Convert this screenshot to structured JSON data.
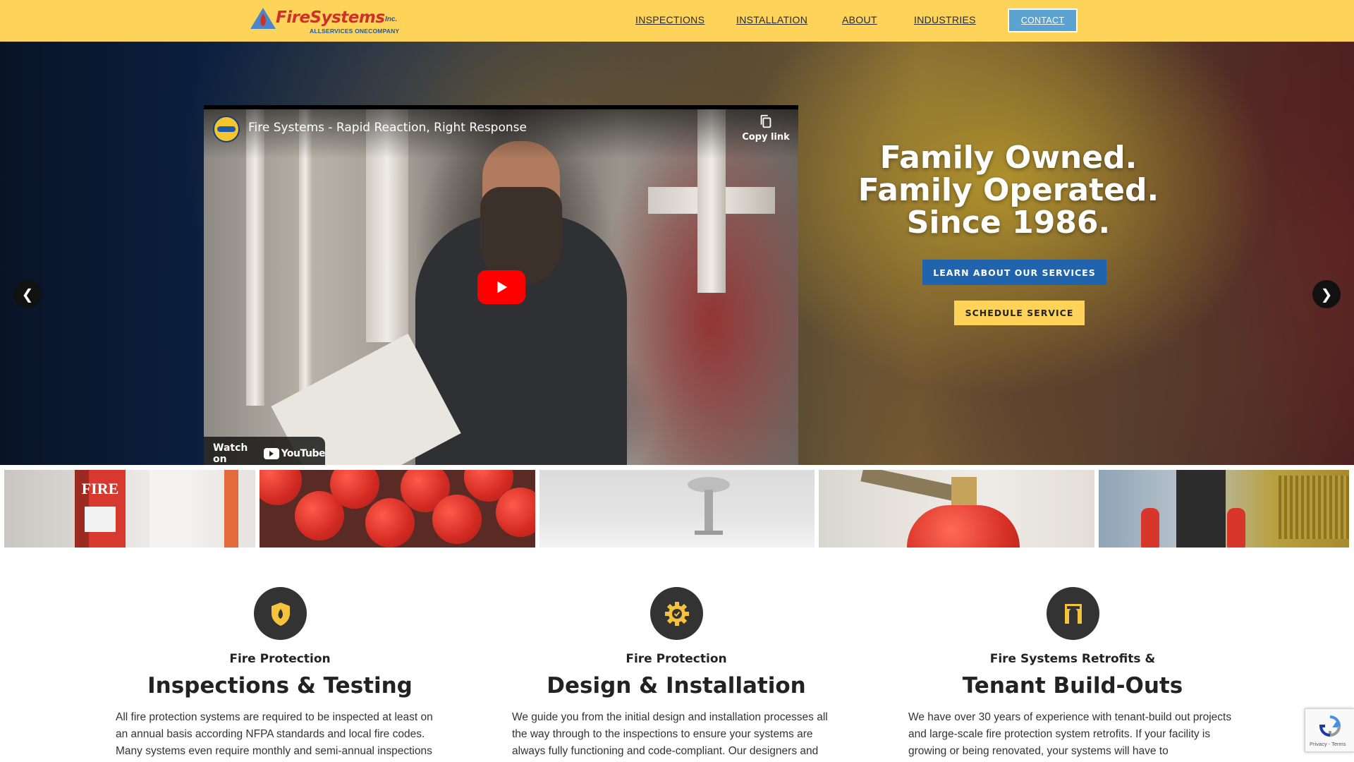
{
  "header": {
    "logo": {
      "name": "FireSystems",
      "suffix": "Inc.",
      "tagline": "ALLSERVICES ONECOMPANY"
    },
    "nav": [
      "INSPECTIONS",
      "INSTALLATION",
      "ABOUT",
      "INDUSTRIES"
    ],
    "contact_label": "CONTACT",
    "colors": {
      "header_bg": "#fdd35a",
      "contact_bg": "#5aa2cf"
    }
  },
  "hero": {
    "video": {
      "title": "Fire Systems - Rapid Reaction, Right Response",
      "copy_link_label": "Copy link",
      "watch_on_label": "Watch on",
      "youtube_label": "YouTube"
    },
    "heading_lines": [
      "Family Owned.",
      "Family Operated.",
      "Since 1986."
    ],
    "learn_button": "LEARN ABOUT OUR SERVICES",
    "schedule_button": "SCHEDULE SERVICE",
    "prev_icon": "chevron-left-icon",
    "next_icon": "chevron-right-icon",
    "colors": {
      "learn_bg": "#1f64ad",
      "schedule_bg": "#fdd35a"
    }
  },
  "thumbnails": [
    {
      "name": "fire-alarm-pull-station",
      "label": "FIRE"
    },
    {
      "name": "fire-extinguishers"
    },
    {
      "name": "ceiling-sprinkler"
    },
    {
      "name": "suppression-tank"
    },
    {
      "name": "vehicle-extinguishers"
    }
  ],
  "features": [
    {
      "icon": "shield-flame-icon",
      "eyebrow": "Fire Protection",
      "title": "Inspections & Testing",
      "body": "All fire protection systems are required to be inspected at least on an annual basis according NFPA standards and local fire codes. Many systems even require monthly and semi-annual inspections"
    },
    {
      "icon": "gear-check-icon",
      "eyebrow": "Fire Protection",
      "title": "Design & Installation",
      "body": "We guide you from the initial design and installation processes all the way through to the inspections to ensure your systems are always fully functioning and code-compliant. Our designers and"
    },
    {
      "icon": "blueprint-icon",
      "eyebrow": "Fire Systems Retrofits &",
      "title": "Tenant Build-Outs",
      "body": "We have over 30 years of experience with tenant-build out projects and large-scale fire protection system retrofits. If your facility is growing or being renovated, your systems will have to"
    }
  ],
  "recaptcha": {
    "footer": "Privacy - Terms"
  }
}
